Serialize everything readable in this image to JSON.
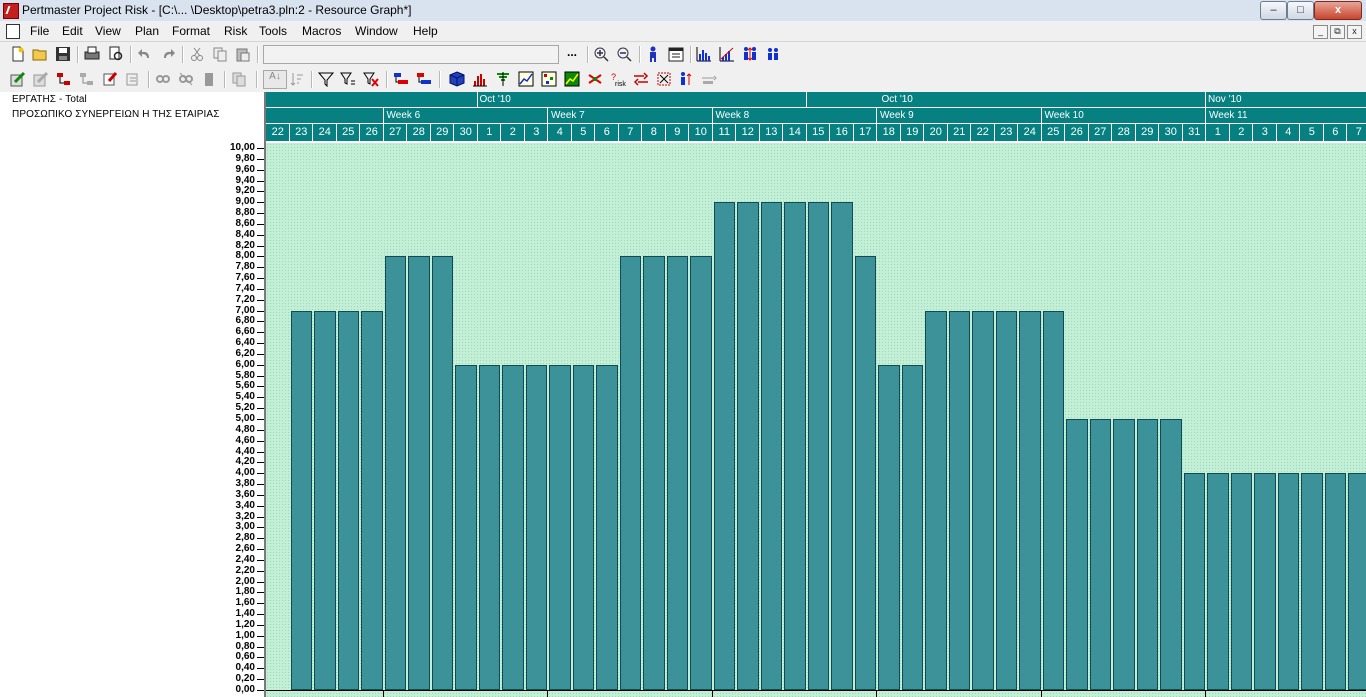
{
  "window": {
    "title": "Pertmaster Project Risk - [C:\\... \\Desktop\\petra3.pln:2 - Resource Graph*]",
    "controls": [
      "–",
      "□",
      "x"
    ]
  },
  "menu": [
    "File",
    "Edit",
    "View",
    "Plan",
    "Format",
    "Risk",
    "Tools",
    "Macros",
    "Window",
    "Help"
  ],
  "mdi_controls": [
    "_",
    "⧉",
    "x"
  ],
  "toolbar1": {
    "combo_value": "",
    "combo_button": "...",
    "icons": [
      "new-icon",
      "open-icon",
      "save-icon",
      "print-icon",
      "print-preview-icon",
      "undo-icon",
      "redo-icon",
      "cut-icon",
      "copy-icon",
      "paste-icon",
      "zoom-in-icon",
      "zoom-out-icon",
      "resource-icon",
      "calendar-icon",
      "histogram-icon",
      "cumulative-icon",
      "resource-levels-icon",
      "resource-team-icon"
    ]
  },
  "toolbar2": {
    "sort_label": "A↓",
    "icons": [
      "edit-task-icon",
      "task-info-icon",
      "link-icon",
      "unlink-icon",
      "notes-icon",
      "indent-icon",
      "outdent-icon",
      "filter-icon",
      "filter-clear-icon",
      "delete-filter-icon",
      "group-icon",
      "ungroup-icon",
      "cube-icon",
      "distribution-icon",
      "tornado-icon",
      "criticality-icon",
      "scatter-icon",
      "risk-register-icon",
      "risk-icon",
      "correlate-icon",
      "merge-icon",
      "resource-swap-icon",
      "collapse-icon"
    ]
  },
  "left_panel": {
    "resource_total": "ΕΡΓΑΤΗΣ - Total",
    "resource_desc": "ΠΡΟΣΩΠΙΚΟ ΣΥΝΕΡΓΕΙΩΝ Η ΤΗΣ ΕΤΑΙΡΙΑΣ"
  },
  "timescale": {
    "months": [
      {
        "label": "Oct '10",
        "start_day_index": 9
      },
      {
        "label": "Oct '10",
        "start_day_index": 23
      },
      {
        "label": "Nov '10",
        "start_day_index": 40
      }
    ],
    "weeks": [
      {
        "label": "Week 6",
        "start_day_index": 5
      },
      {
        "label": "Week 7",
        "start_day_index": 12
      },
      {
        "label": "Week 8",
        "start_day_index": 19
      },
      {
        "label": "Week 9",
        "start_day_index": 26
      },
      {
        "label": "Week 10",
        "start_day_index": 33
      },
      {
        "label": "Week 11",
        "start_day_index": 40
      }
    ],
    "days": [
      "22",
      "23",
      "24",
      "25",
      "26",
      "27",
      "28",
      "29",
      "30",
      "1",
      "2",
      "3",
      "4",
      "5",
      "6",
      "7",
      "8",
      "9",
      "10",
      "11",
      "12",
      "13",
      "14",
      "15",
      "16",
      "17",
      "18",
      "19",
      "20",
      "21",
      "22",
      "23",
      "24",
      "25",
      "26",
      "27",
      "28",
      "29",
      "30",
      "31",
      "1",
      "2",
      "3",
      "4",
      "5",
      "6",
      "7"
    ]
  },
  "chart_data": {
    "type": "bar",
    "title": "",
    "xlabel": "",
    "ylabel": "",
    "ylim": [
      0,
      10
    ],
    "y_ticks": [
      "0,00",
      "0,20",
      "0,40",
      "0,60",
      "0,80",
      "1,00",
      "1,20",
      "1,40",
      "1,60",
      "1,80",
      "2,00",
      "2,20",
      "2,40",
      "2,60",
      "2,80",
      "3,00",
      "3,20",
      "3,40",
      "3,60",
      "3,80",
      "4,00",
      "4,20",
      "4,40",
      "4,60",
      "4,80",
      "5,00",
      "5,20",
      "5,40",
      "5,60",
      "5,80",
      "6,00",
      "6,20",
      "6,40",
      "6,60",
      "6,80",
      "7,00",
      "7,20",
      "7,40",
      "7,60",
      "7,80",
      "8,00",
      "8,20",
      "8,40",
      "8,60",
      "8,80",
      "9,00",
      "9,20",
      "9,40",
      "9,60",
      "9,80",
      "10,00"
    ],
    "categories": [
      "22",
      "23",
      "24",
      "25",
      "26",
      "27",
      "28",
      "29",
      "30",
      "1",
      "2",
      "3",
      "4",
      "5",
      "6",
      "7",
      "8",
      "9",
      "10",
      "11",
      "12",
      "13",
      "14",
      "15",
      "16",
      "17",
      "18",
      "19",
      "20",
      "21",
      "22",
      "23",
      "24",
      "25",
      "26",
      "27",
      "28",
      "29",
      "30",
      "31",
      "1",
      "2",
      "3",
      "4",
      "5",
      "6",
      "7"
    ],
    "values": [
      0,
      7,
      7,
      7,
      7,
      8,
      8,
      8,
      6,
      6,
      6,
      6,
      6,
      6,
      6,
      8,
      8,
      8,
      8,
      9,
      9,
      9,
      9,
      9,
      9,
      8,
      6,
      6,
      7,
      7,
      7,
      7,
      7,
      7,
      5,
      5,
      5,
      5,
      5,
      4,
      4,
      4,
      4,
      4,
      4,
      4,
      4
    ],
    "grid": false,
    "colors": {
      "background": "#c4efd7",
      "bar": "#47a4aa",
      "bar_border": "#0f4b55",
      "header": "#068080"
    }
  }
}
